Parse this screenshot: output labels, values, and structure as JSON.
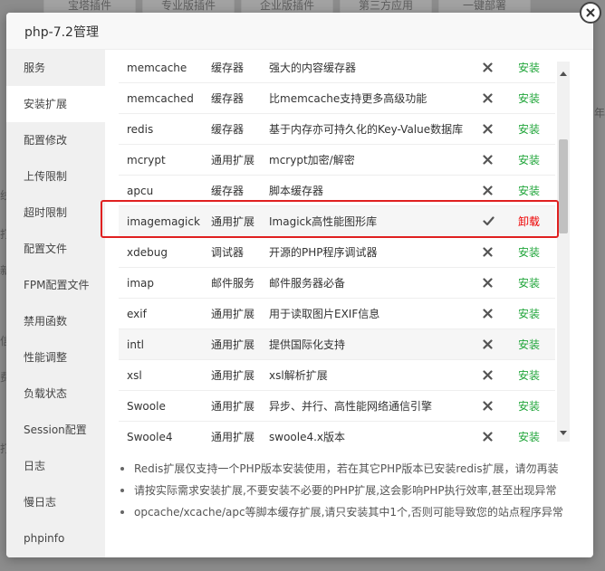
{
  "background": {
    "tabs": [
      "宝塔插件",
      "专业版插件",
      "企业版插件",
      "第三方应用",
      "一键部署"
    ],
    "side_chars": [
      "线",
      "打",
      "新",
      "信",
      "费",
      "打"
    ],
    "right_char": "年"
  },
  "modal": {
    "title": "php-7.2管理"
  },
  "sidebar": {
    "items": [
      {
        "label": "服务"
      },
      {
        "label": "安装扩展"
      },
      {
        "label": "配置修改"
      },
      {
        "label": "上传限制"
      },
      {
        "label": "超时限制"
      },
      {
        "label": "配置文件"
      },
      {
        "label": "FPM配置文件"
      },
      {
        "label": "禁用函数"
      },
      {
        "label": "性能调整"
      },
      {
        "label": "负载状态"
      },
      {
        "label": "Session配置"
      },
      {
        "label": "日志"
      },
      {
        "label": "慢日志"
      },
      {
        "label": "phpinfo"
      }
    ],
    "active_index": 1
  },
  "extensions": [
    {
      "name": "memcache",
      "type": "缓存器",
      "desc": "强大的内容缓存器",
      "installed": false,
      "action": "安装"
    },
    {
      "name": "memcached",
      "type": "缓存器",
      "desc": "比memcache支持更多高级功能",
      "installed": false,
      "action": "安装"
    },
    {
      "name": "redis",
      "type": "缓存器",
      "desc": "基于内存亦可持久化的Key-Value数据库",
      "installed": false,
      "action": "安装"
    },
    {
      "name": "mcrypt",
      "type": "通用扩展",
      "desc": "mcrypt加密/解密",
      "installed": false,
      "action": "安装"
    },
    {
      "name": "apcu",
      "type": "缓存器",
      "desc": "脚本缓存器",
      "installed": false,
      "action": "安装"
    },
    {
      "name": "imagemagick",
      "type": "通用扩展",
      "desc": "Imagick高性能图形库",
      "installed": true,
      "action": "卸载"
    },
    {
      "name": "xdebug",
      "type": "调试器",
      "desc": "开源的PHP程序调试器",
      "installed": false,
      "action": "安装"
    },
    {
      "name": "imap",
      "type": "邮件服务",
      "desc": "邮件服务器必备",
      "installed": false,
      "action": "安装"
    },
    {
      "name": "exif",
      "type": "通用扩展",
      "desc": "用于读取图片EXIF信息",
      "installed": false,
      "action": "安装"
    },
    {
      "name": "intl",
      "type": "通用扩展",
      "desc": "提供国际化支持",
      "installed": false,
      "action": "安装"
    },
    {
      "name": "xsl",
      "type": "通用扩展",
      "desc": "xsl解析扩展",
      "installed": false,
      "action": "安装"
    },
    {
      "name": "Swoole",
      "type": "通用扩展",
      "desc": "异步、并行、高性能网络通信引擎",
      "installed": false,
      "action": "安装"
    },
    {
      "name": "Swoole4",
      "type": "通用扩展",
      "desc": "swoole4.x版本",
      "installed": false,
      "action": "安装"
    }
  ],
  "notes": [
    "Redis扩展仅支持一个PHP版本安装使用，若在其它PHP版本已安装redis扩展，请勿再装",
    "请按实际需求安装扩展,不要安装不必要的PHP扩展,这会影响PHP执行效率,甚至出现异常",
    "opcache/xcache/apc等脚本缓存扩展,请只安装其中1个,否则可能导致您的站点程序异常"
  ],
  "colors": {
    "install": "#20a53a",
    "uninstall": "#e00000",
    "highlight": "#e02020"
  },
  "icons": {
    "not_installed": "x-icon",
    "installed": "check-icon",
    "close": "close-icon"
  }
}
